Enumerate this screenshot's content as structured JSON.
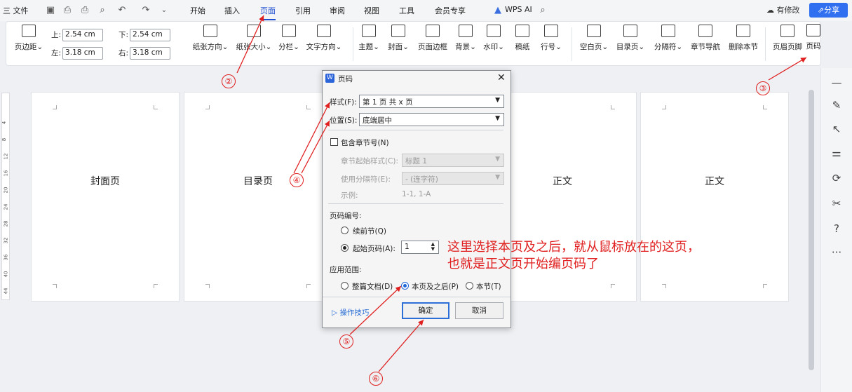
{
  "menubar": {
    "file_label": "三 文件",
    "tabs": [
      "开始",
      "插入",
      "页面",
      "引用",
      "审阅",
      "视图",
      "工具",
      "会员专享"
    ],
    "active_tab": "页面",
    "wps_ai": "WPS AI",
    "modified_label": "有修改",
    "share_label": "分享"
  },
  "ribbon": {
    "margin_label": "页边距",
    "top_label": "上:",
    "top_value": "2.54  cm",
    "bottom_label": "下:",
    "bottom_value": "2.54  cm",
    "left_label": "左:",
    "left_value": "3.18  cm",
    "right_label": "右:",
    "right_value": "3.18  cm",
    "buttons": [
      "纸张方向",
      "纸张大小",
      "分栏",
      "文字方向",
      "主题",
      "封面",
      "页面边框",
      "背景",
      "水印",
      "稿纸",
      "行号",
      "空白页",
      "目录页",
      "分隔符",
      "章节导航",
      "删除本节",
      "页眉页脚",
      "页码"
    ]
  },
  "pages": [
    "封面页",
    "目录页",
    "",
    "正文",
    "正文"
  ],
  "ruler_numbers": [
    "4",
    "8",
    "12",
    "16",
    "20",
    "24",
    "28",
    "32",
    "36",
    "40",
    "44"
  ],
  "dialog": {
    "title": "页码",
    "style_label": "样式(F):",
    "style_value": "第 1 页 共 x 页",
    "position_label": "位置(S):",
    "position_value": "底端居中",
    "include_chapter": "包含章节号(N)",
    "chapter_style_label": "章节起始样式(C):",
    "chapter_style_value": "标题 1",
    "separator_label": "使用分隔符(E):",
    "separator_value": "-   (连字符)",
    "example_label": "示例:",
    "example_value": "1-1, 1-A",
    "numbering_label": "页码编号:",
    "continue_label": "续前节(Q)",
    "start_label": "起始页码(A):",
    "start_value": "1",
    "scope_label": "应用范围:",
    "scope_whole": "整篇文档(D)",
    "scope_after": "本页及之后(P)",
    "scope_section": "本节(T)",
    "tips_label": "操作技巧",
    "ok_label": "确定",
    "cancel_label": "取消"
  },
  "annotation": {
    "line1": "这里选择本页及之后，就从鼠标放在的这页，",
    "line2": "也就是正文页开始编页码了",
    "numbers": [
      "②",
      "③",
      "④",
      "⑤",
      "⑥"
    ]
  },
  "colors": {
    "accent": "#1f4fd1",
    "annotation": "#e02020",
    "share": "#2f6ff0"
  }
}
